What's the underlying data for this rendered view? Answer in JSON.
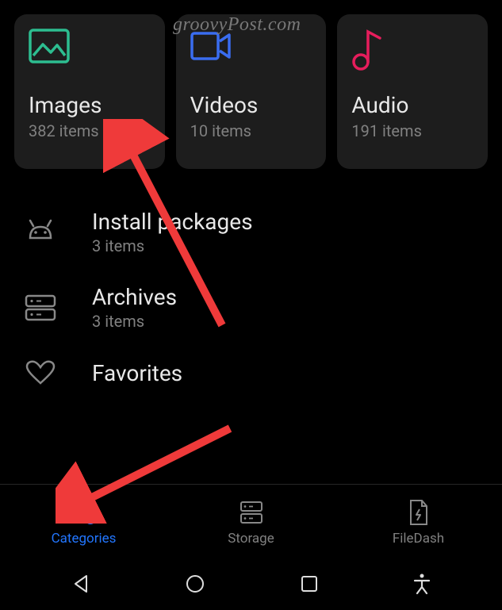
{
  "watermark": "groovyPost.com",
  "cards": [
    {
      "title": "Images",
      "subtitle": "382 items",
      "icon": "image-icon",
      "accent": "#2dbd90"
    },
    {
      "title": "Videos",
      "subtitle": "10 items",
      "icon": "video-icon",
      "accent": "#3a6df0"
    },
    {
      "title": "Audio",
      "subtitle": "191 items",
      "icon": "audio-icon",
      "accent": "#e61d5c"
    }
  ],
  "listItems": [
    {
      "title": "Install packages",
      "subtitle": "3 items",
      "icon": "android-icon"
    },
    {
      "title": "Archives",
      "subtitle": "3 items",
      "icon": "archive-icon"
    },
    {
      "title": "Favorites",
      "subtitle": "",
      "icon": "heart-icon"
    }
  ],
  "tabs": [
    {
      "label": "Categories",
      "icon": "shapes-icon",
      "active": true
    },
    {
      "label": "Storage",
      "icon": "storage-icon",
      "active": false
    },
    {
      "label": "FileDash",
      "icon": "filedash-icon",
      "active": false
    }
  ],
  "nav": [
    "back",
    "home",
    "recent",
    "accessibility"
  ]
}
